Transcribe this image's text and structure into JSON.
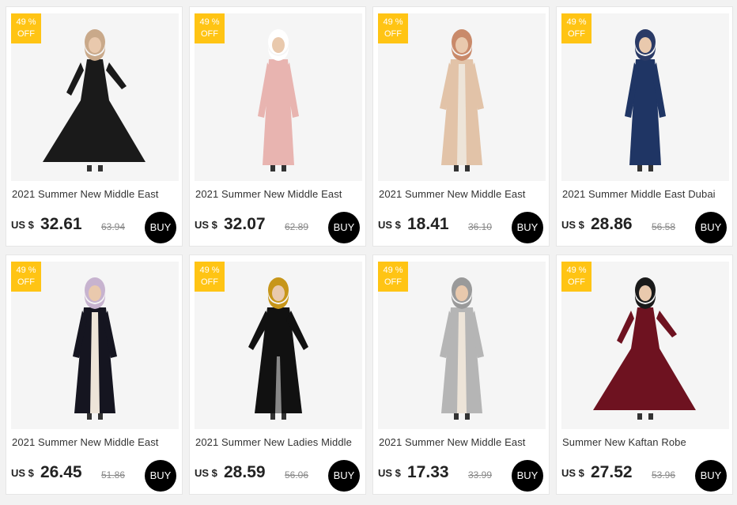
{
  "products": [
    {
      "title": "2021 Summer New Middle East",
      "currency": "US $",
      "price": "32.61",
      "old_price": "63.94",
      "buy": "BUY",
      "badge_pct": "49 %",
      "badge_off": "OFF",
      "dress_color": "#1a1a1a",
      "hijab_color": "#c9a98a",
      "style": "flare"
    },
    {
      "title": "2021 Summer New Middle East",
      "currency": "US $",
      "price": "32.07",
      "old_price": "62.89",
      "buy": "BUY",
      "badge_pct": "49 %",
      "badge_off": "OFF",
      "dress_color": "#e8b4b0",
      "hijab_color": "#ffffff",
      "style": "straight"
    },
    {
      "title": "2021 Summer New Middle East",
      "currency": "US $",
      "price": "18.41",
      "old_price": "36.10",
      "buy": "BUY",
      "badge_pct": "49 %",
      "badge_off": "OFF",
      "dress_color": "#e2c3a8",
      "hijab_color": "#c98a6a",
      "style": "open"
    },
    {
      "title": "2021 Summer Middle East Dubai",
      "currency": "US $",
      "price": "28.86",
      "old_price": "56.58",
      "buy": "BUY",
      "badge_pct": "49 %",
      "badge_off": "OFF",
      "dress_color": "#1f3564",
      "hijab_color": "#2a3a66",
      "style": "straight"
    },
    {
      "title": "2021 Summer New Middle East",
      "currency": "US $",
      "price": "26.45",
      "old_price": "51.86",
      "buy": "BUY",
      "badge_pct": "49 %",
      "badge_off": "OFF",
      "dress_color": "#151520",
      "hijab_color": "#c7b3cf",
      "style": "open"
    },
    {
      "title": "2021 Summer New Ladies Middle",
      "currency": "US $",
      "price": "28.59",
      "old_price": "56.06",
      "buy": "BUY",
      "badge_pct": "49 %",
      "badge_off": "OFF",
      "dress_color": "#111111",
      "hijab_color": "#c7961a",
      "style": "pants"
    },
    {
      "title": "2021 Summer New Middle East",
      "currency": "US $",
      "price": "17.33",
      "old_price": "33.99",
      "buy": "BUY",
      "badge_pct": "49 %",
      "badge_off": "OFF",
      "dress_color": "#b5b5b5",
      "hijab_color": "#9a9a9a",
      "style": "open"
    },
    {
      "title": "Summer New Kaftan Robe",
      "currency": "US $",
      "price": "27.52",
      "old_price": "53.96",
      "buy": "BUY",
      "badge_pct": "49 %",
      "badge_off": "OFF",
      "dress_color": "#6e1220",
      "hijab_color": "#1a1a1a",
      "style": "flare"
    }
  ]
}
